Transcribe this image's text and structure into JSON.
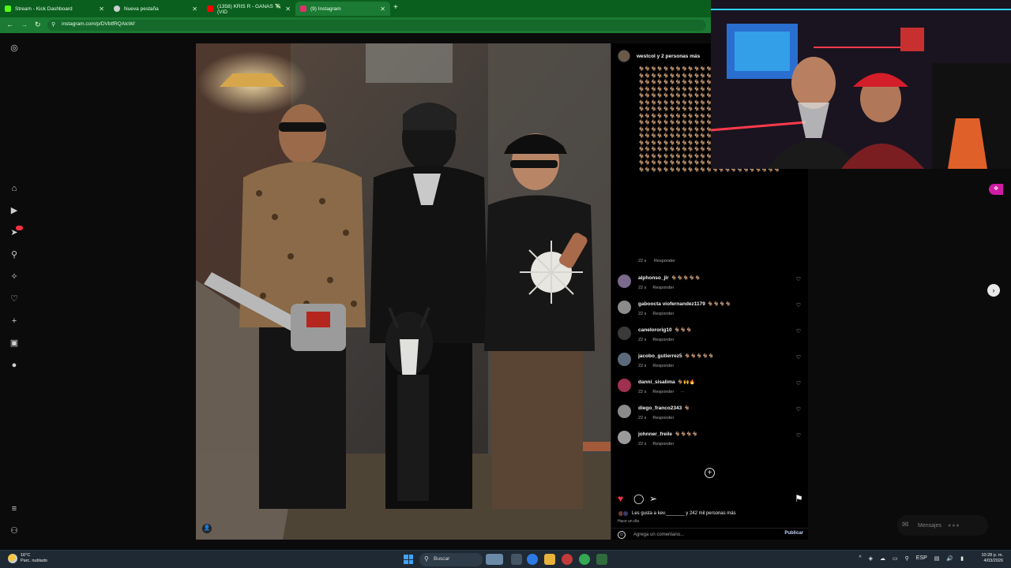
{
  "browser": {
    "tabs": [
      {
        "label": "Stream - Kick Dashboard",
        "favicon_color": "#53fc18"
      },
      {
        "label": "Nueva pestaña",
        "favicon_color": "#cfcfcf"
      },
      {
        "label": "(1358) KRIS R - GANAS 💸 (VID",
        "favicon_color": "#ff0000"
      },
      {
        "label": "(9) Instagram",
        "favicon_color": "#e1306c"
      }
    ],
    "url": "instagram.com/p/DVbtfRQAlcW/"
  },
  "post": {
    "author": "westcol y 2 personas más",
    "caption_emojis": "🐐🐐🐐🐐🐐🐐🐐🐐🐐🐐🐐🐐🐐🐐🐐🐐🐐🐐🐐🐐🐐🐐🐐🐐🐐🐐🐐🐐🐐🐐🐐🐐🐐🐐🐐🐐🐐🐐🐐🐐🐐🐐🐐🐐🐐🐐🐐🐐🐐🐐🐐🐐🐐🐐🐐🐐🐐🐐🐐🐐🐐🐐🐐🐐🐐🐐🐐🐐🐐🐐🐐🐐🐐🐐🐐🐐🐐🐐🐐🐐🐐🐐🐐🐐🐐🐐🐐🐐🐐🐐🐐🐐🐐🐐🐐🐐🐐🐐🐐🐐🐐🐐🐐🐐🐐🐐🐐🐐🐐🐐🐐🐐🐐🐐🐐🐐🐐🐐🐐🐐🐐🐐🐐🐐🐐🐐🐐🐐🐐🐐🐐🐐🐐🐐🐐🐐🐐🐐🐐🐐🐐🐐🐐🐐🐐🐐🐐🐐🐐🐐🐐🐐🐐🐐🐐🐐🐐🐐🐐🐐🐐🐐🐐🐐🐐🐐🐐🐐🐐🐐🐐🐐🐐🐐🐐🐐🐐🐐🐐🐐🐐🐐🐐🐐🐐🐐🐐🐐🐐🐐🐐🐐🐐🐐🐐🐐🐐🐐🐐🐐🐐🐐🐐🐐🐐🐐🐐🐐🐐🐐🐐🐐🐐🐐🐐🐐🐐🐐🐐🐐🐐🐐🐐🐐🐐🐐🐐🐐🐐🐐🐐🐐🐐🐐🐐🐐🐐🐐🐐🐐🐐🐐🐐🐐🐐🐐🐐🐐🐐🐐🐐🐐🐐🐐🐐🐐🐐🐐🐐🐐🐐🐐🐐🐐🐐🐐🐐🐐🐐🐐🐐🐐🐐🐐🐐🐐🐐🐐🐐🐐🐐🐐🐐🐐🐐🐐🐐🐐🐐🐐🐐🐐🐐🐐🐐🐐🐐🐐🐐🐐🐐🐐🐐🐐🐐🐐🐐🐐🐐🐐🐐🐐🐐🐐🐐🐐🐐🐐🐐🐐🐐🐐🐐🐐🐐🐐🐐🐐🐐🐐🐐🐐🐐🐐🐐🐐🐐🐐🐐🐐🐐🐐🐐🐐🐐🐐🐐🐐🐐🐐🐐🐐🐐🐐🐐🐐🐐🐐🐐🐐🐐🐐🐐🐐🐐🐐🐐🐐🐐🐐🐐🐐🐐🐐🐐🐐🐐🐐🐐🐐🐐🐐🐐",
    "caption_time": "22 s",
    "reply_label": "Responder",
    "likes_text": "Les gusta a kev._______ y 242 mil personas más",
    "posted_ago": "Hace un día",
    "comment_placeholder": "Agrega un comentario...",
    "publish_label": "Publicar"
  },
  "comments": [
    {
      "user": "alphonso_jlr",
      "text": "🐐🐐🐐🐐🐐",
      "time": "22 s",
      "reply": "Responder",
      "avatar_color": "#7a6a8c"
    },
    {
      "user": "gaboocta viofernandez1179",
      "text": "🐐🐐🐐🐐",
      "time": "22 s",
      "reply": "Responder",
      "avatar_color": "#8b8b8b"
    },
    {
      "user": "canelororig10",
      "text": "🐐🐐🐐",
      "time": "22 s",
      "reply": "Responder",
      "avatar_color": "#3a3a3a"
    },
    {
      "user": "jacobo_gutierrez5",
      "text": "🐐🐐🐐🐐🐐",
      "time": "22 s",
      "reply": "Responder",
      "avatar_color": "#5a6a7a"
    },
    {
      "user": "danni_sisalima",
      "text": "🐐🙌🔥",
      "time": "22 s",
      "reply": "Responder",
      "avatar_color": "#a03050"
    },
    {
      "user": "diego_franco2343",
      "text": "🐐",
      "time": "22 s",
      "reply": "Responder",
      "avatar_color": "#8b8b8b"
    },
    {
      "user": "johnner_freile",
      "text": "🐐🐐🐐🐐",
      "time": "22 s",
      "reply": "Responder",
      "avatar_color": "#9a9a9a"
    }
  ],
  "messages_label": "Mensajes",
  "taskbar": {
    "temp": "16°C",
    "weather": "Parc. nublado",
    "search": "Buscar",
    "lang": "ESP",
    "time": "10:28 p. m.",
    "date": "4/03/2026"
  },
  "colors": {
    "like_red": "#ff3040",
    "kick_pink": "#d01ca3"
  }
}
